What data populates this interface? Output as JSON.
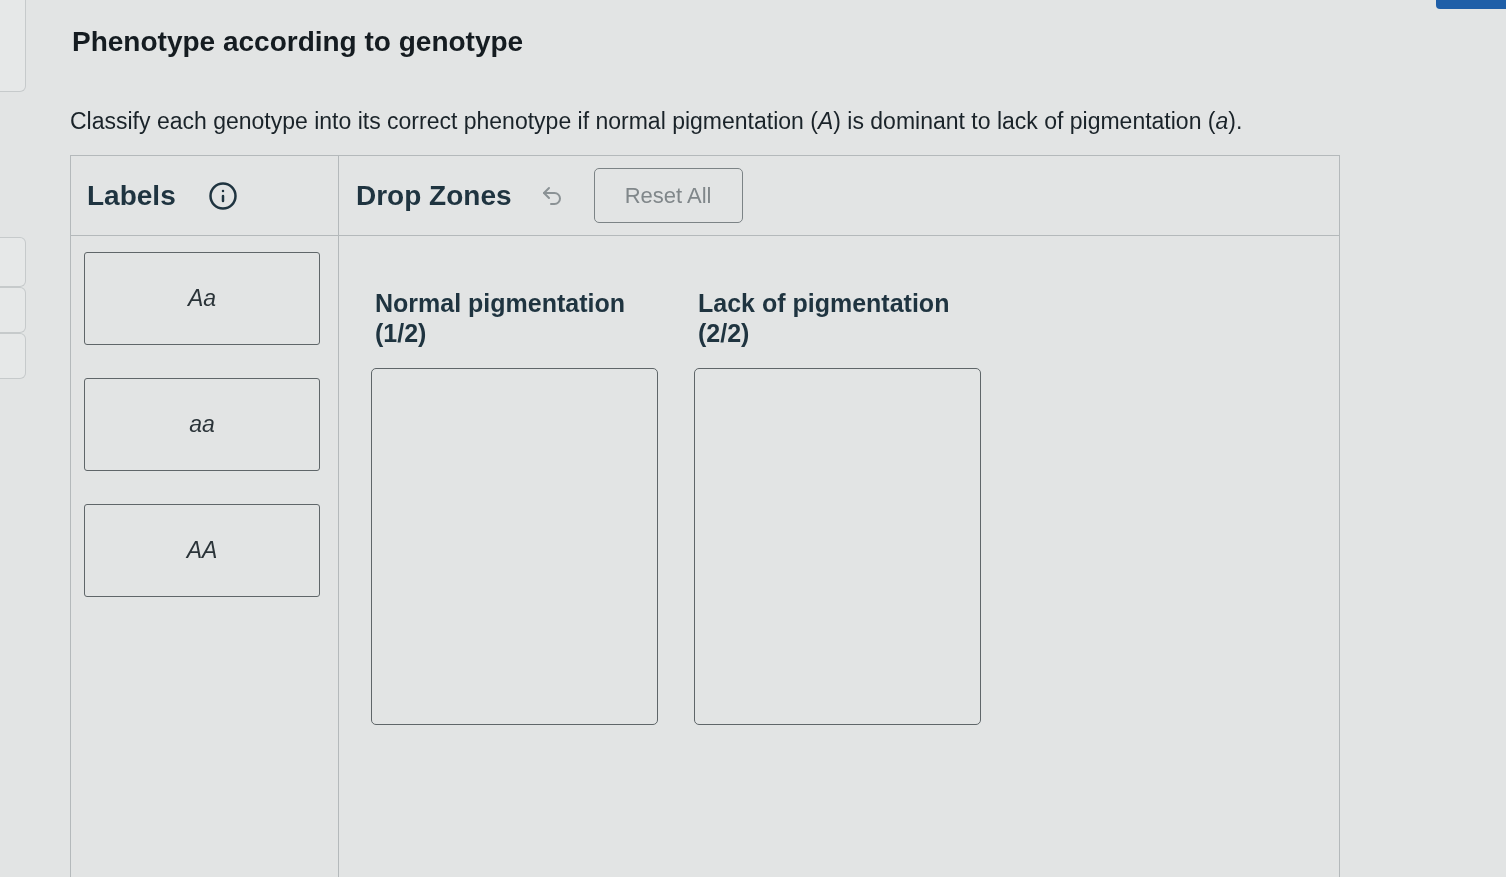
{
  "title": "Phenotype according to genotype",
  "instructions": "Classify each genotype into its correct phenotype if normal pigmentation (*A*) is dominant to lack of pigmentation (*a*).",
  "labels_panel": {
    "heading": "Labels",
    "items": [
      "Aa",
      "aa",
      "AA"
    ]
  },
  "drop_zones_panel": {
    "heading": "Drop Zones",
    "reset_button": {
      "label": "Reset All",
      "disabled": true
    },
    "zones": [
      {
        "heading": "Normal pigmentation (1/2)"
      },
      {
        "heading": "Lack of pigmentation (2/2)"
      }
    ]
  }
}
